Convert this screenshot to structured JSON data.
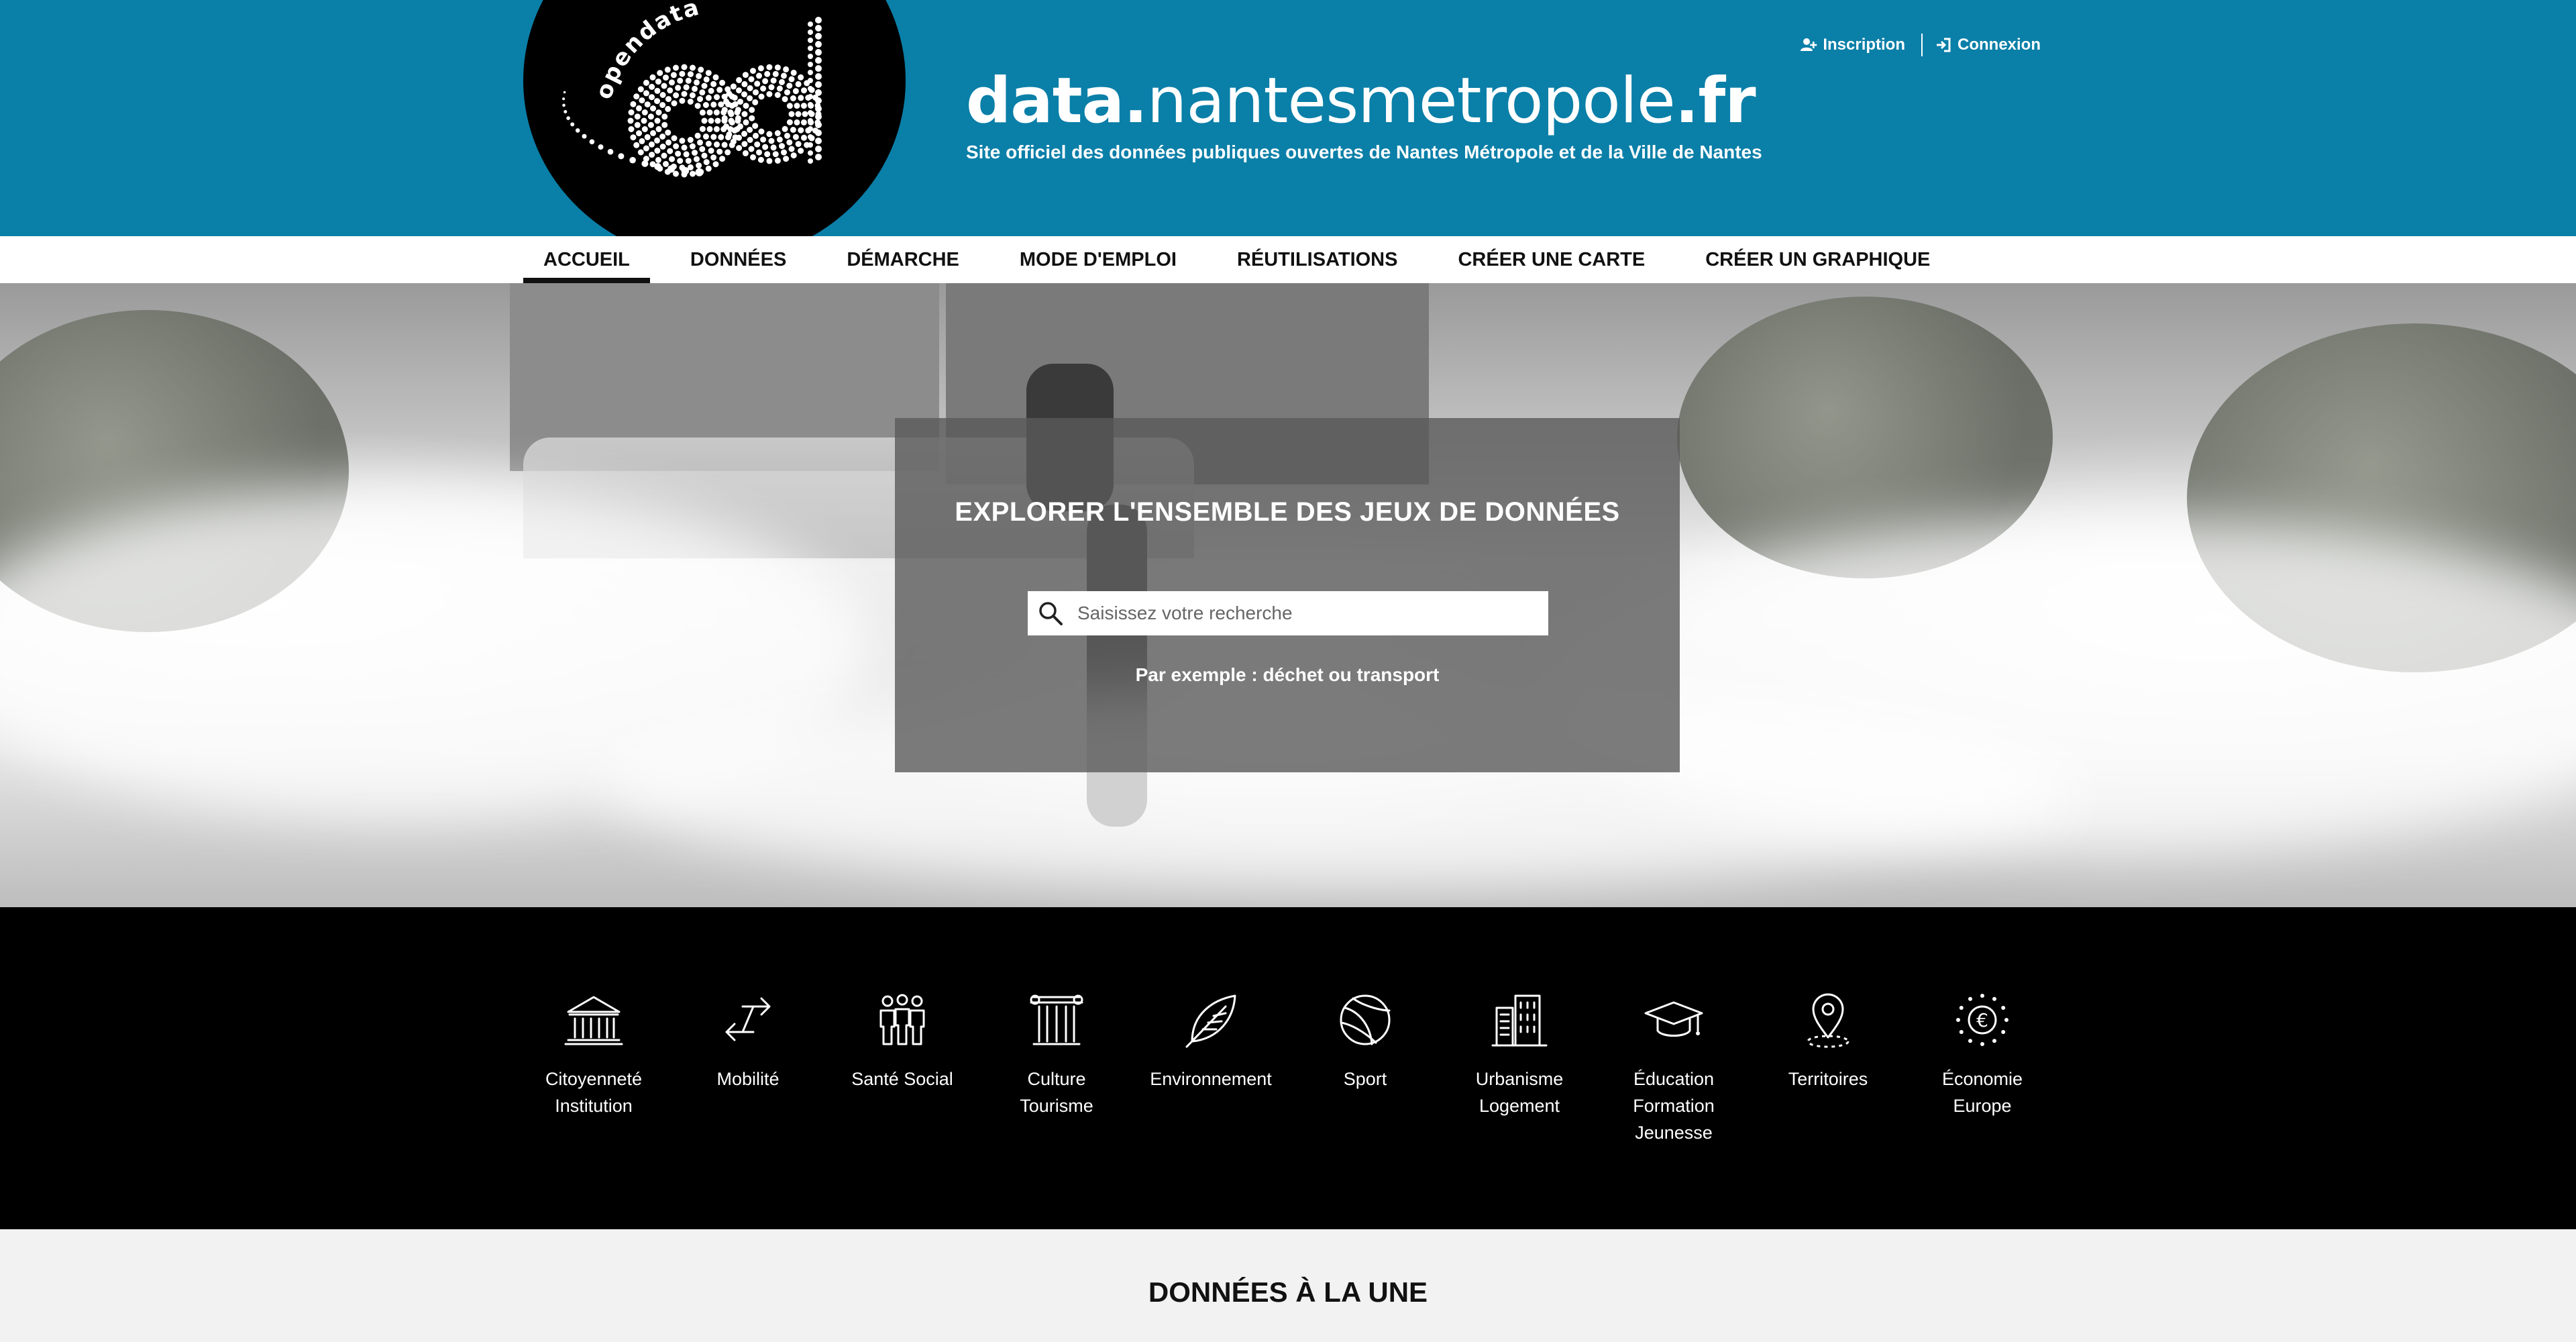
{
  "header": {
    "logo_text": "opendata",
    "title_bold_1": "data.",
    "title_light": "nantesmetropole",
    "title_bold_2": ".fr",
    "subtitle": "Site officiel des données publiques ouvertes de Nantes Métropole et de la Ville de Nantes",
    "auth": {
      "register_label": "Inscription",
      "register_icon": "user-plus-icon",
      "login_label": "Connexion",
      "login_icon": "sign-in-icon"
    },
    "colors": {
      "header_bg": "#0a7fa8"
    }
  },
  "nav": {
    "items": [
      {
        "label": "ACCUEIL",
        "active": true
      },
      {
        "label": "DONNÉES"
      },
      {
        "label": "DÉMARCHE"
      },
      {
        "label": "MODE D'EMPLOI"
      },
      {
        "label": "RÉUTILISATIONS"
      },
      {
        "label": "CRÉER UNE CARTE"
      },
      {
        "label": "CRÉER UN GRAPHIQUE"
      }
    ]
  },
  "search": {
    "title": "EXPLORER L'ENSEMBLE DES JEUX DE DONNÉES",
    "placeholder": "Saisissez votre recherche",
    "example": "Par exemple : déchet ou transport"
  },
  "categories": [
    {
      "label": "Citoyenneté\nInstitution",
      "icon": "institution-icon"
    },
    {
      "label": "Mobilité",
      "icon": "arrows-exchange-icon"
    },
    {
      "label": "Santé Social",
      "icon": "people-icon"
    },
    {
      "label": "Culture\nTourisme",
      "icon": "column-icon"
    },
    {
      "label": "Environnement",
      "icon": "leaf-icon"
    },
    {
      "label": "Sport",
      "icon": "ball-icon"
    },
    {
      "label": "Urbanisme\nLogement",
      "icon": "buildings-icon"
    },
    {
      "label": "Éducation\nFormation\nJeunesse",
      "icon": "graduation-cap-icon"
    },
    {
      "label": "Territoires",
      "icon": "map-pin-icon"
    },
    {
      "label": "Économie\nEurope",
      "icon": "euro-stars-icon"
    }
  ],
  "featured": {
    "title": "DONNÉES À LA UNE"
  }
}
